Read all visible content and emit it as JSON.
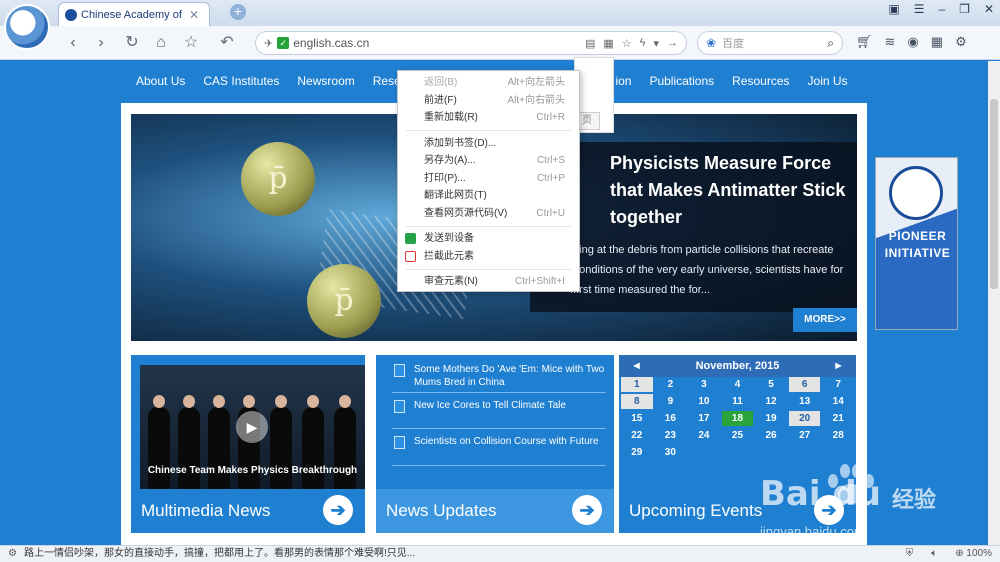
{
  "browser": {
    "tab_title": "Chinese Academy of Sci",
    "tab_close": "✕",
    "new_tab": "+",
    "url": "english.cas.cn",
    "search_placeholder": "百度",
    "zoom": "100%",
    "status_text": "路上一情侣吵架，那女的直接动手，搞撞，把都用上了。看那男的表情那个难受啊!只见..."
  },
  "nav": {
    "items": [
      "About Us",
      "CAS Institutes",
      "Newsroom",
      "Resea",
      "ion",
      "Publications",
      "Resources",
      "Join Us"
    ]
  },
  "hero": {
    "title": "Physicists Measure Force that Makes Antimatter Stick together",
    "summary": "...ing at the debris from particle collisions that recreate ...onditions of the very early universe, scientists have for ...rst time measured the for...",
    "more": "MORE>>",
    "particle_symbol": "p̄"
  },
  "banner": {
    "label": "PIONEER INITIATIVE"
  },
  "multimedia": {
    "caption": "Chinese Team Makes Physics Breakthrough",
    "footer": "Multimedia News"
  },
  "news": {
    "items": [
      "Some Mothers Do 'Ave 'Em: Mice with Two Mums Bred in China",
      "New Ice Cores to Tell Climate Tale",
      "Scientists on Collision Course with Future"
    ],
    "footer": "News Updates"
  },
  "events": {
    "month": "November, 2015",
    "days": [
      "1",
      "2",
      "3",
      "4",
      "5",
      "6",
      "7",
      "8",
      "9",
      "10",
      "11",
      "12",
      "13",
      "14",
      "15",
      "16",
      "17",
      "18",
      "19",
      "20",
      "21",
      "22",
      "23",
      "24",
      "25",
      "26",
      "27",
      "28",
      "29",
      "30"
    ],
    "footer": "Upcoming Events"
  },
  "context_menu": {
    "items": [
      {
        "label": "返回(B)",
        "key": "Alt+向左箭头"
      },
      {
        "label": "前进(F)",
        "key": "Alt+向右箭头"
      },
      {
        "label": "重新加载(R)",
        "key": "Ctrl+R"
      },
      {
        "label": "添加到书签(D)...",
        "key": ""
      },
      {
        "label": "另存为(A)...",
        "key": "Ctrl+S"
      },
      {
        "label": "打印(P)...",
        "key": "Ctrl+P"
      },
      {
        "label": "翻译此网页(T)",
        "key": ""
      },
      {
        "label": "查看网页源代码(V)",
        "key": "Ctrl+U"
      },
      {
        "label": "发送到设备",
        "key": ""
      },
      {
        "label": "拦截此元素",
        "key": ""
      },
      {
        "label": "审查元素(N)",
        "key": "Ctrl+Shift+I"
      }
    ],
    "behind_label": "页"
  },
  "watermark": {
    "brand": "Bai du",
    "brand_cn": "经验",
    "url": "jingyan.baidu.com"
  },
  "colors": {
    "accent": "#1f7fd1",
    "today": "#2aa33b"
  }
}
